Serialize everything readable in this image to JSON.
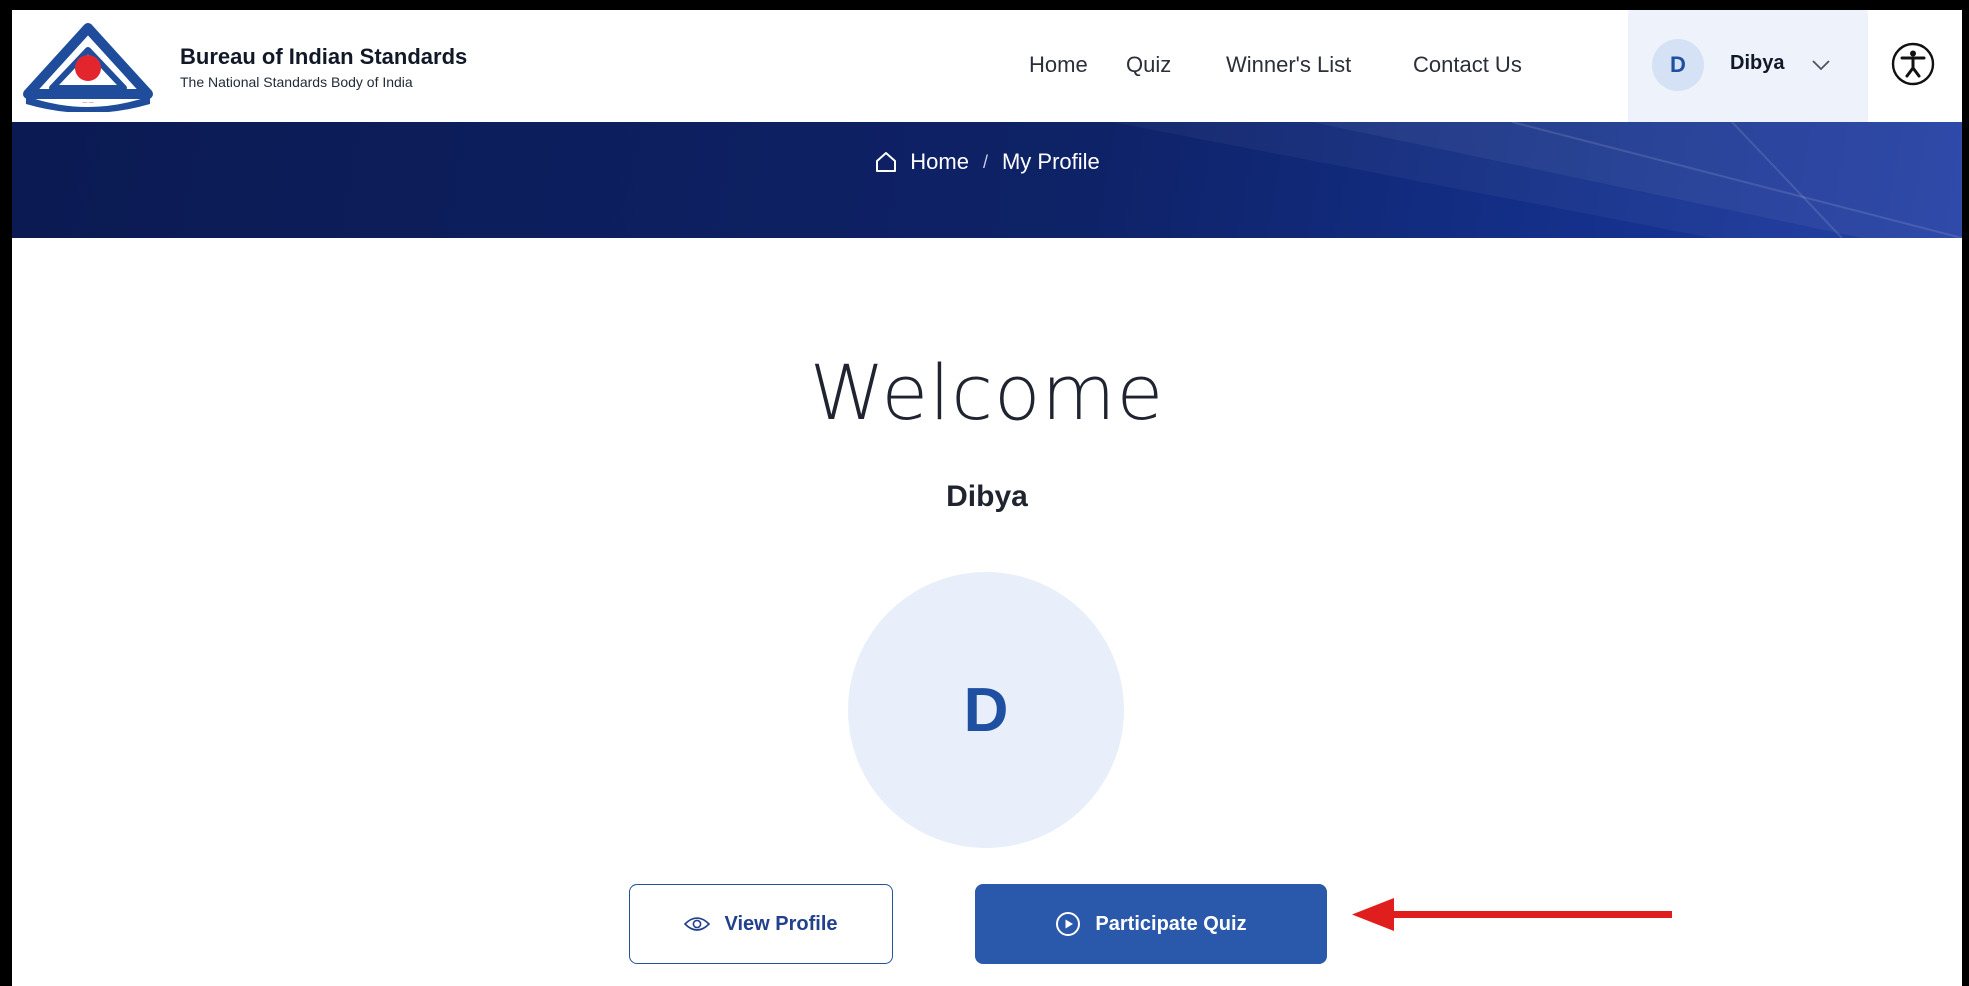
{
  "brand": {
    "title": "Bureau of Indian Standards",
    "subtitle": "The National Standards Body of India",
    "logo_icon": "bis-triangle-logo"
  },
  "nav": {
    "items": [
      {
        "label": "Home"
      },
      {
        "label": "Quiz"
      },
      {
        "label": "Winner's List"
      },
      {
        "label": "Contact Us"
      }
    ]
  },
  "user": {
    "initial": "D",
    "name": "Dibya",
    "menu_icon": "chevron-down-icon"
  },
  "accessibility": {
    "icon": "accessibility-icon"
  },
  "breadcrumb": {
    "home_label": "Home",
    "separator": "/",
    "current": "My Profile"
  },
  "main": {
    "welcome": "Welcome",
    "user_name": "Dibya",
    "avatar_initial": "D",
    "view_profile_label": "View Profile",
    "participate_label": "Participate Quiz"
  },
  "colors": {
    "primary": "#2a58ab",
    "banner": "#0e2267",
    "avatar_bg": "#e9effa",
    "annotation_arrow": "#e01e1e"
  }
}
